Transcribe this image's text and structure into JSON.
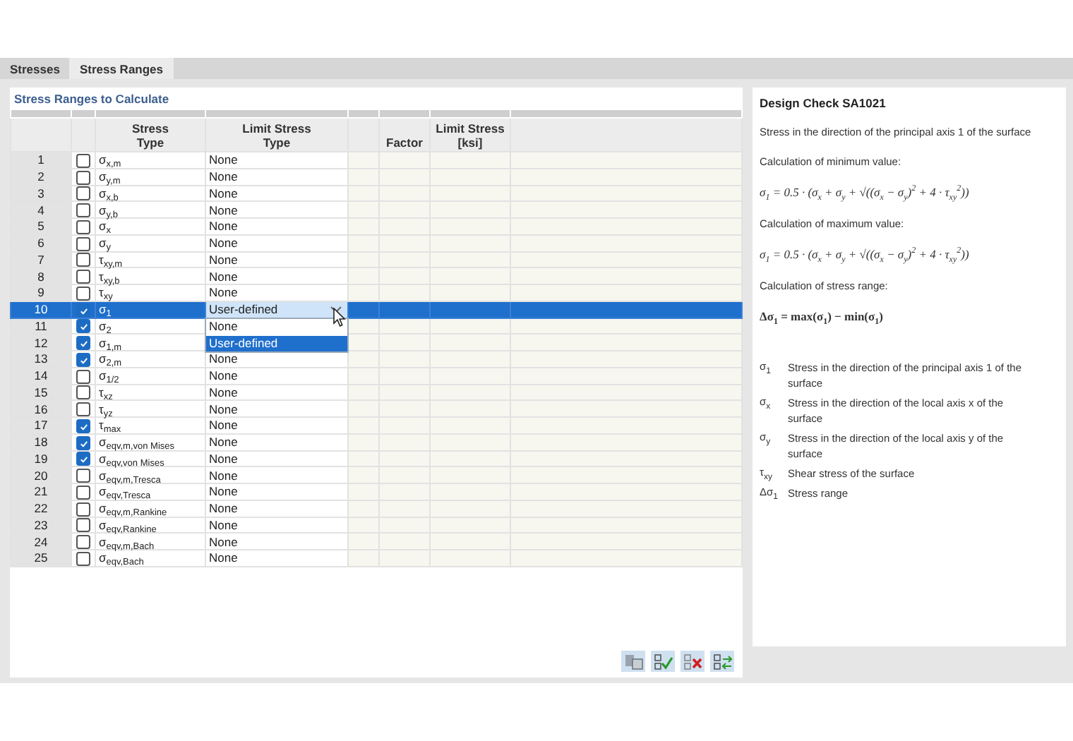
{
  "tabs": [
    {
      "label": "Stresses",
      "selected": false
    },
    {
      "label": "Stress Ranges",
      "selected": true
    }
  ],
  "table": {
    "title": "Stress Ranges to Calculate",
    "headings": [
      {
        "lines": [
          "Stress",
          "Type"
        ]
      },
      {
        "lines": [
          "Limit Stress",
          "Type"
        ]
      },
      {
        "lines": [
          "Factor"
        ]
      },
      {
        "lines": [
          "Limit Stress",
          "[ksi]"
        ]
      }
    ],
    "rows": [
      {
        "no": "1",
        "checked": false,
        "stress_type": "σ$_{x,m}$",
        "limit_type": "None",
        "selected": false
      },
      {
        "no": "2",
        "checked": false,
        "stress_type": "σ$_{y,m}$",
        "limit_type": "None",
        "selected": false
      },
      {
        "no": "3",
        "checked": false,
        "stress_type": "σ$_{x,b}$",
        "limit_type": "None",
        "selected": false
      },
      {
        "no": "4",
        "checked": false,
        "stress_type": "σ$_{y,b}$",
        "limit_type": "None",
        "selected": false
      },
      {
        "no": "5",
        "checked": false,
        "stress_type": "σ$_{x}$",
        "limit_type": "None",
        "selected": false
      },
      {
        "no": "6",
        "checked": false,
        "stress_type": "σ$_{y}$",
        "limit_type": "None",
        "selected": false
      },
      {
        "no": "7",
        "checked": false,
        "stress_type": "τ$_{xy,m}$",
        "limit_type": "None",
        "selected": false
      },
      {
        "no": "8",
        "checked": false,
        "stress_type": "τ$_{xy,b}$",
        "limit_type": "None",
        "selected": false
      },
      {
        "no": "9",
        "checked": false,
        "stress_type": "τ$_{xy}$",
        "limit_type": "None",
        "selected": false
      },
      {
        "no": "10",
        "checked": true,
        "stress_type": "σ$_{1}$",
        "limit_type": "User-defined",
        "selected": true,
        "dropdown": {
          "options": [
            {
              "label": "None",
              "selected": false
            },
            {
              "label": "User-defined",
              "selected": true
            }
          ]
        }
      },
      {
        "no": "11",
        "checked": true,
        "stress_type": "σ$_{2}$",
        "selected": false
      },
      {
        "no": "12",
        "checked": true,
        "stress_type": "σ$_{1,m}$",
        "selected": false
      },
      {
        "no": "13",
        "checked": true,
        "stress_type": "σ$_{2,m}$",
        "limit_type": "None",
        "selected": false
      },
      {
        "no": "14",
        "checked": false,
        "stress_type": "σ$_{1/2}$",
        "limit_type": "None",
        "selected": false
      },
      {
        "no": "15",
        "checked": false,
        "stress_type": "τ$_{xz}$",
        "limit_type": "None",
        "selected": false
      },
      {
        "no": "16",
        "checked": false,
        "stress_type": "τ$_{yz}$",
        "limit_type": "None",
        "selected": false
      },
      {
        "no": "17",
        "checked": true,
        "stress_type": "τ$_{max}$",
        "limit_type": "None",
        "selected": false
      },
      {
        "no": "18",
        "checked": true,
        "stress_type": "σ$_{eqv,m,von Mises}$",
        "limit_type": "None",
        "selected": false
      },
      {
        "no": "19",
        "checked": true,
        "stress_type": "σ$_{eqv,von Mises}$",
        "limit_type": "None",
        "selected": false
      },
      {
        "no": "20",
        "checked": false,
        "stress_type": "σ$_{eqv,m,Tresca}$",
        "limit_type": "None",
        "selected": false
      },
      {
        "no": "21",
        "checked": false,
        "stress_type": "σ$_{eqv,Tresca}$",
        "limit_type": "None",
        "selected": false
      },
      {
        "no": "22",
        "checked": false,
        "stress_type": "σ$_{eqv,m,Rankine}$",
        "limit_type": "None",
        "selected": false
      },
      {
        "no": "23",
        "checked": false,
        "stress_type": "σ$_{eqv,Rankine}$",
        "limit_type": "None",
        "selected": false
      },
      {
        "no": "24",
        "checked": false,
        "stress_type": "σ$_{eqv,m,Bach}$",
        "limit_type": "None",
        "selected": false
      },
      {
        "no": "25",
        "checked": false,
        "stress_type": "σ$_{eqv,Bach}$",
        "limit_type": "None",
        "selected": false
      }
    ]
  },
  "info": {
    "title": "Design Check SA1021",
    "blocks": [
      {
        "kind": "text",
        "text": "Stress in the direction of the principal axis 1 of the surface"
      },
      {
        "kind": "text",
        "text": "Calculation of minimum value:"
      },
      {
        "kind": "formula",
        "text": "σ$_{1}$ = 0.5 · (σ$_{x}$ + σ$_{y}$ + √((σ$_{x}$ − σ$_{y}$)$^{2}$ + 4 · τ$_{xy}$$^{2}$))"
      },
      {
        "kind": "text",
        "text": "Calculation of maximum value:"
      },
      {
        "kind": "formula",
        "text": "σ$_{1}$ = 0.5 · (σ$_{x}$ + σ$_{y}$ + √((σ$_{x}$ − σ$_{y}$)$^{2}$ + 4 · τ$_{xy}$$^{2}$))"
      },
      {
        "kind": "text",
        "text": "Calculation of stress range:"
      },
      {
        "kind": "result",
        "text": "Δσ$_{1}$ = max(σ$_{1}$) − min(σ$_{1}$)"
      }
    ],
    "legend": [
      {
        "symbol": "σ$_{1}$",
        "text": "Stress in the direction of the principal axis 1 of the surface"
      },
      {
        "symbol": "σ$_{x}$",
        "text": "Stress in the direction of the local axis x of the surface"
      },
      {
        "symbol": "σ$_{y}$",
        "text": "Stress in the direction of the local axis y of the surface"
      },
      {
        "symbol": "τ$_{xy}$",
        "text": "Shear stress of the surface"
      },
      {
        "symbol": "Δσ$_{1}$",
        "text": "Stress range"
      }
    ]
  }
}
